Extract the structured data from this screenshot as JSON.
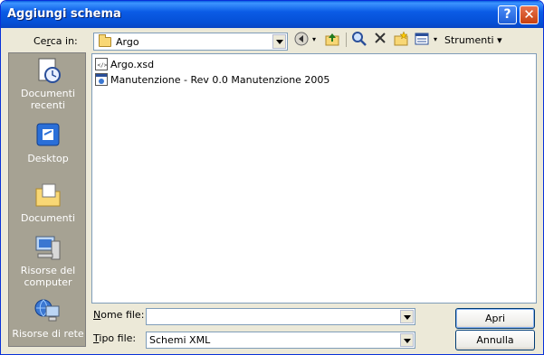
{
  "window": {
    "title": "Aggiungi schema",
    "help_label": "?",
    "close_label": "✕"
  },
  "lookin": {
    "label_prefix": "Ce",
    "label_accel": "r",
    "label_suffix": "ca in:",
    "value": "Argo"
  },
  "toolbar": {
    "back_icon": "back-arrow-icon",
    "up_icon": "up-folder-icon",
    "search_icon": "search-web-icon",
    "delete_icon": "delete-icon",
    "new_folder_icon": "new-folder-icon",
    "views_icon": "views-icon",
    "tools_label": "Strumenti"
  },
  "places": [
    {
      "label": "Documenti recenti",
      "icon": "recent-documents-icon"
    },
    {
      "label": "Desktop",
      "icon": "desktop-icon"
    },
    {
      "label": "Documenti",
      "icon": "documents-icon"
    },
    {
      "label": "Risorse del computer",
      "icon": "my-computer-icon"
    },
    {
      "label": "Risorse di rete",
      "icon": "network-icon"
    }
  ],
  "files": [
    {
      "name": "Argo.xsd",
      "icon": "xsd-file-icon"
    },
    {
      "name": "Manutenzione - Rev 0.0 Manutenzione 2005",
      "icon": "web-file-icon"
    }
  ],
  "filename": {
    "label_accel": "N",
    "label_rest": "ome file:",
    "value": ""
  },
  "filetype": {
    "label_accel": "T",
    "label_rest": "ipo file:",
    "value": "Schemi XML"
  },
  "buttons": {
    "open": "Apri",
    "cancel": "Annulla"
  }
}
